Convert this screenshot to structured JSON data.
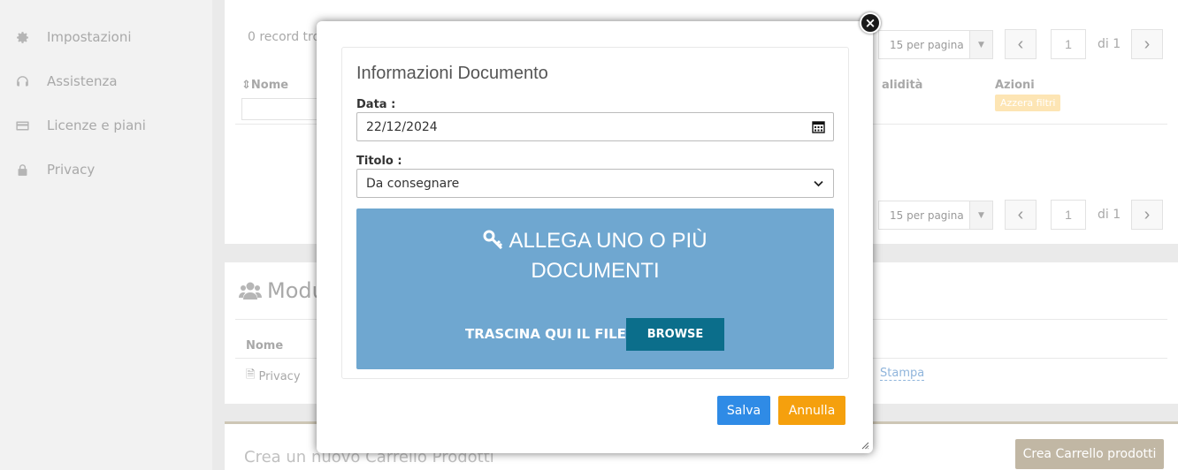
{
  "sidebar": {
    "items": [
      {
        "label": "Impostazioni",
        "icon": "gear-icon"
      },
      {
        "label": "Assistenza",
        "icon": "headset-icon"
      },
      {
        "label": "Licenze e piani",
        "icon": "credit-card-icon"
      },
      {
        "label": "Privacy",
        "icon": "lock-icon"
      }
    ]
  },
  "records_panel": {
    "records_text": "0 record tro",
    "columns": {
      "nome": "Nome",
      "validita": "alidità",
      "azioni": "Azioni"
    },
    "azzera_filtri": "Azzera filtri",
    "pagination_top": {
      "per_page": "15 per pagina",
      "page": "1",
      "of": "di 1"
    },
    "pagination_bottom": {
      "per_page": "15 per pagina",
      "page": "1",
      "of": "di 1"
    }
  },
  "moduli_panel": {
    "title": "Modu",
    "col_nome": "Nome",
    "row_name": "Privacy",
    "stampa": "Stampa"
  },
  "carrello": {
    "text": "Crea un nuovo Carrello Prodotti",
    "button": "Crea Carrello prodotti"
  },
  "modal": {
    "title": "Informazioni Documento",
    "data_label": "Data :",
    "data_value": "22/12/2024",
    "titolo_label": "Titolo :",
    "titolo_value": "Da consegnare",
    "dropzone_line1": "ALLEGA UNO O PIÙ",
    "dropzone_line2": "DOCUMENTI",
    "dropzone_drag": "TRASCINA QUI IL FILE -",
    "browse": "BROWSE",
    "save": "Salva",
    "cancel": "Annulla",
    "close_glyph": "×"
  },
  "colors": {
    "dropzone": "#6fa7d0",
    "browse": "#0b6e8b",
    "save": "#2f8be6",
    "cancel": "#f5a00d",
    "carrello_button": "#b7ab95"
  }
}
